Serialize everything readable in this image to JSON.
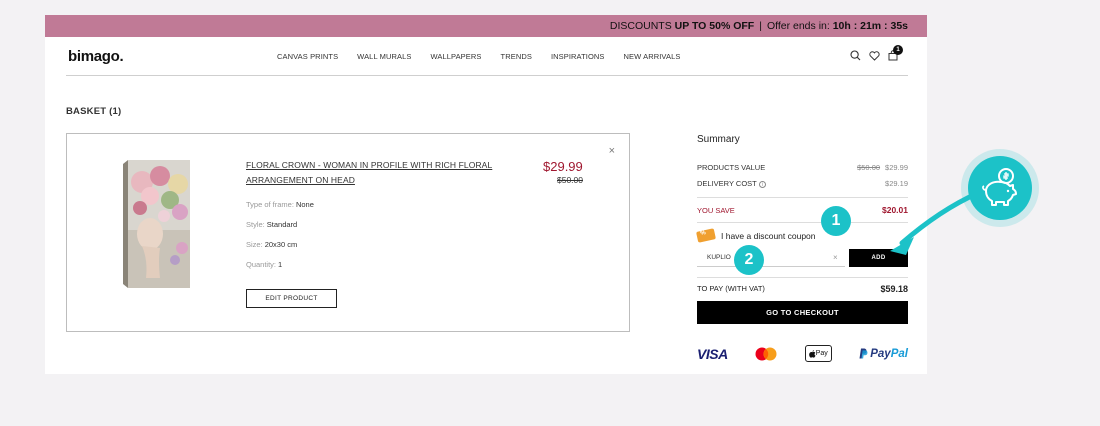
{
  "promo": {
    "prefix": "DISCOUNTS",
    "highlight": "UP TO 50% OFF",
    "separator": "|",
    "offer_label": "Offer ends in:",
    "countdown": "10h : 21m : 35s"
  },
  "header": {
    "logo": "bimago.",
    "nav": [
      "CANVAS PRINTS",
      "WALL MURALS",
      "WALLPAPERS",
      "TRENDS",
      "INSPIRATIONS",
      "NEW ARRIVALS"
    ],
    "cart_count": "1",
    "icons": [
      "search-icon",
      "heart-icon",
      "bag-icon"
    ]
  },
  "basket": {
    "title": "BASKET (1)",
    "item": {
      "title": "FLORAL CROWN - WOMAN IN PROFILE WITH RICH FLORAL ARRANGEMENT ON HEAD",
      "price": "$29.99",
      "old_price": "$50.00",
      "specs": [
        {
          "label": "Type of frame:",
          "value": "None"
        },
        {
          "label": "Style:",
          "value": "Standard"
        },
        {
          "label": "Size:",
          "value": "20x30 cm"
        },
        {
          "label": "Quantity:",
          "value": "1"
        }
      ],
      "edit_label": "EDIT PRODUCT",
      "remove_symbol": "×"
    }
  },
  "summary": {
    "title": "Summary",
    "products_label": "PRODUCTS VALUE",
    "products_old": "$50.00",
    "products_value": "$29.99",
    "delivery_label": "DELIVERY COST",
    "delivery_info": "i",
    "delivery_value": "$29.19",
    "save_label": "YOU SAVE",
    "save_value": "$20.01",
    "coupon_label": "I have a discount coupon",
    "coupon_value": "KUPLIO",
    "coupon_clear": "×",
    "add_label": "ADD",
    "topay_label": "TO PAY (WITH VAT)",
    "topay_value": "$59.18",
    "checkout_label": "GO TO CHECKOUT",
    "payments": {
      "visa": "VISA",
      "applepay": "Pay",
      "paypal_a": "Pay",
      "paypal_b": "Pal"
    }
  },
  "annotations": {
    "marker1": "1",
    "marker2": "2"
  },
  "colors": {
    "promo_bar": "#c07a96",
    "price_red": "#a01830",
    "accent_teal": "#1cc2c8"
  }
}
